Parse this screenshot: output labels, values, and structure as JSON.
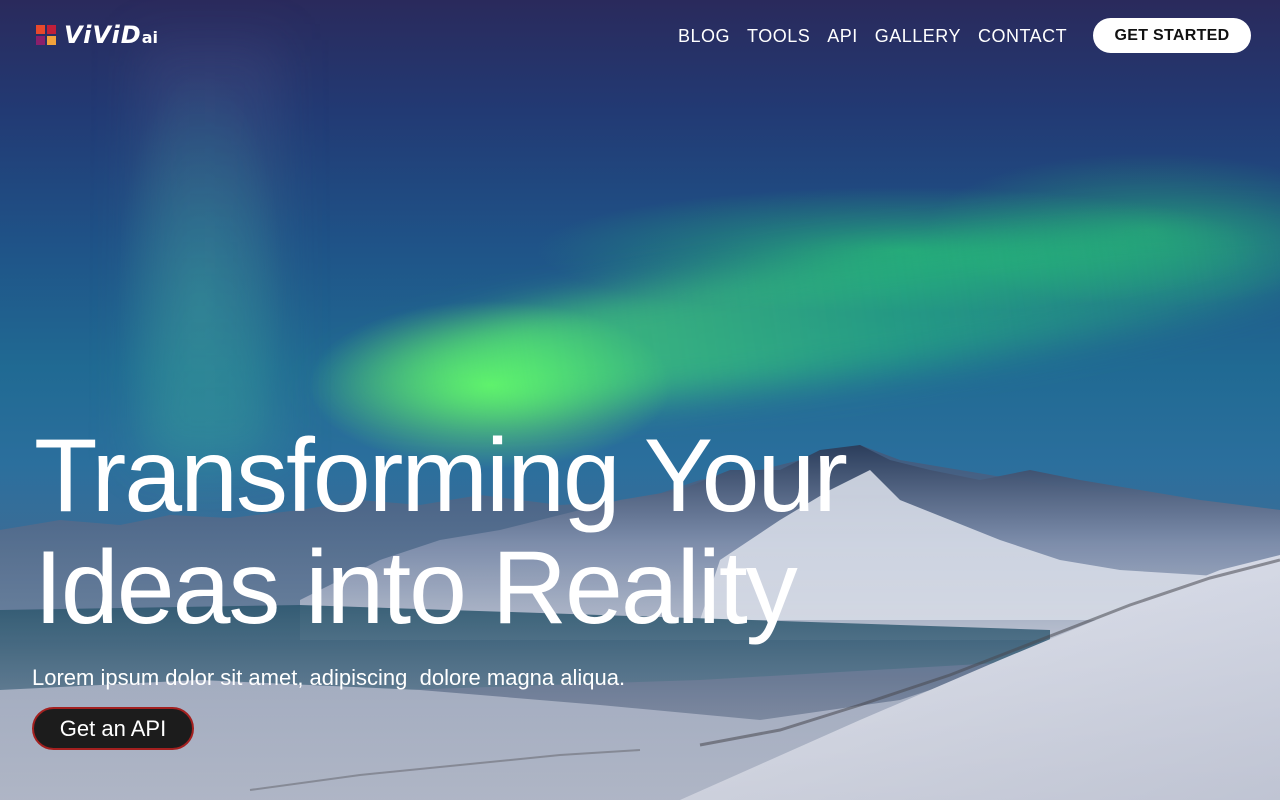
{
  "brand": {
    "logo_text": "ViViD",
    "logo_suffix": "ai",
    "logo_colors": [
      "#e8492b",
      "#c01f3a",
      "#8a1f6b",
      "#f2a23c"
    ]
  },
  "nav": {
    "items": [
      {
        "label": "BLOG"
      },
      {
        "label": "TOOLS"
      },
      {
        "label": "API"
      },
      {
        "label": "GALLERY"
      },
      {
        "label": "CONTACT"
      }
    ],
    "cta_label": "GET STARTED"
  },
  "hero": {
    "headline_line1": "Transforming Your",
    "headline_line2": "Ideas into Reality",
    "subtext": "Lorem ipsum dolor sit amet, adipiscing  dolore magna aliqua.",
    "button_label": "Get an API",
    "background": "aurora-over-snowy-mountains-image"
  },
  "colors": {
    "accent_border": "#a3201f",
    "button_dark": "#1c1c1c",
    "text_light": "#ffffff"
  }
}
